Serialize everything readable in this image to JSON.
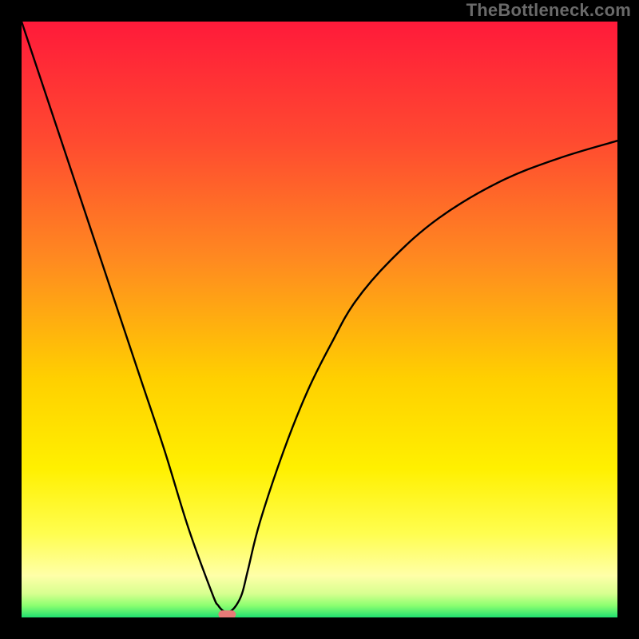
{
  "branding": "TheBottleneck.com",
  "chart_data": {
    "type": "line",
    "title": "",
    "xlabel": "",
    "ylabel": "",
    "xlim": [
      0,
      100
    ],
    "ylim": [
      0,
      100
    ],
    "gradient_stops": [
      {
        "offset": 0,
        "color": "#ff1a3a"
      },
      {
        "offset": 20,
        "color": "#ff4a30"
      },
      {
        "offset": 40,
        "color": "#ff8a20"
      },
      {
        "offset": 60,
        "color": "#ffd000"
      },
      {
        "offset": 75,
        "color": "#fff000"
      },
      {
        "offset": 86,
        "color": "#fffe50"
      },
      {
        "offset": 93,
        "color": "#ffffa8"
      },
      {
        "offset": 96,
        "color": "#d8ff90"
      },
      {
        "offset": 98,
        "color": "#8cff70"
      },
      {
        "offset": 100,
        "color": "#20e070"
      }
    ],
    "curve": {
      "x": [
        0,
        4,
        8,
        12,
        16,
        20,
        24,
        28,
        32,
        33,
        34,
        35,
        36,
        37,
        38,
        40,
        44,
        48,
        52,
        56,
        62,
        70,
        80,
        90,
        100
      ],
      "y": [
        100,
        88,
        76,
        64,
        52,
        40,
        28,
        15,
        4,
        2,
        1,
        1,
        2,
        4,
        8,
        16,
        28,
        38,
        46,
        53,
        60,
        67,
        73,
        77,
        80
      ]
    },
    "marker": {
      "x": 34.5,
      "y": 0.5
    }
  }
}
